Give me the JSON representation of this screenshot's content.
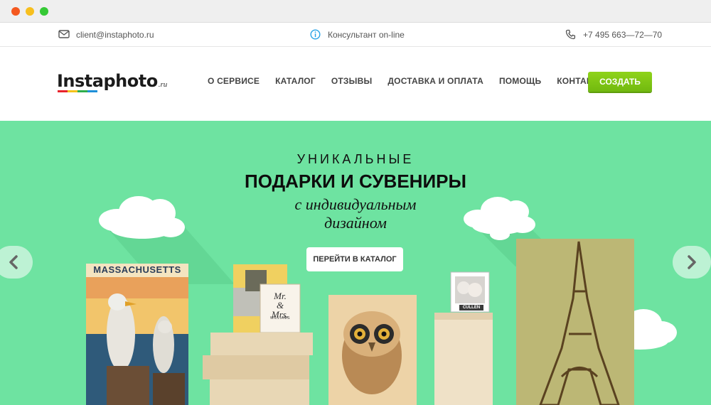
{
  "window": {
    "controls": [
      "close",
      "minimize",
      "maximize"
    ],
    "colors": {
      "close": "#f4581f",
      "minimize": "#f7bf1e",
      "maximize": "#35c935"
    }
  },
  "topbar": {
    "email": "client@instaphoto.ru",
    "consultant": "Консультант on-line",
    "phone": "+7  495  663—72—70",
    "icons": {
      "email": "envelope-icon",
      "consultant": "info-icon",
      "phone": "phone-icon"
    }
  },
  "header": {
    "logo": {
      "name": "Instaphoto",
      "tld": ".ru",
      "stripe_colors": [
        "#e8242c",
        "#f5c21b",
        "#2fae4c",
        "#1e8fd8"
      ]
    },
    "nav": [
      "О СЕРВИСЕ",
      "КАТАЛОГ",
      "ОТЗЫВЫ",
      "ДОСТАВКА И ОПЛАТА",
      "ПОМОЩЬ",
      "КОНТАКТЫ"
    ],
    "create_button": "СОЗДАТЬ"
  },
  "hero": {
    "background": "#6ee3a1",
    "subtitle": "УНИКАЛЬНЫЕ",
    "title": "ПОДАРКИ И СУВЕНИРЫ",
    "italic_line1": "с индивидуальным",
    "italic_line2": "дизайном",
    "catalog_button": "ПЕРЕЙТИ В КАТАЛОГ",
    "prev_icon": "chevron-left-icon",
    "next_icon": "chevron-right-icon",
    "products": {
      "massachusetts": "MASSACHUSETTS",
      "mr": "Mr.",
      "and": "&",
      "mrs": "Mrs.",
      "williams": "WILLIAMS",
      "cullen": "CULLEN"
    }
  }
}
